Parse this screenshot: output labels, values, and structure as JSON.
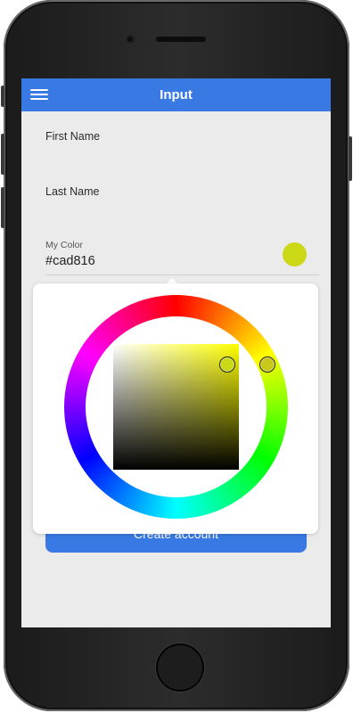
{
  "header": {
    "title": "Input",
    "menu_icon": "hamburger-menu-icon"
  },
  "form": {
    "first_name_label": "First Name",
    "last_name_label": "Last Name",
    "color_label": "My Color",
    "color_value": "#cad816",
    "submit_label": "Create account"
  },
  "color_picker": {
    "selected_hex": "#cad816",
    "hue_handle_color": "#c8c81a",
    "sv_handle_color": "#cad816"
  },
  "colors": {
    "accent": "#3979e4",
    "background": "#ebebeb"
  }
}
